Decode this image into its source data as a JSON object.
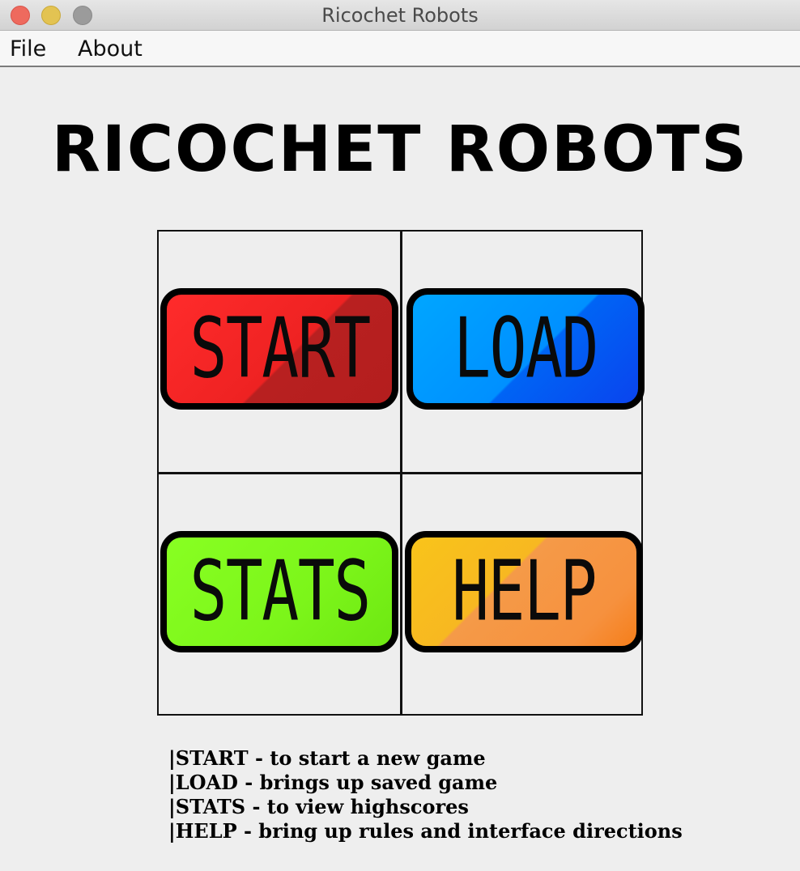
{
  "window": {
    "title": "Ricochet Robots"
  },
  "menubar": {
    "items": [
      "File",
      "About"
    ]
  },
  "heading": "RICOCHET ROBOTS",
  "buttons": [
    {
      "label": "START",
      "color": "#ee2222"
    },
    {
      "label": "LOAD",
      "color": "#0090ff"
    },
    {
      "label": "STATS",
      "color": "#7cf51a"
    },
    {
      "label": "HELP",
      "color": "#f6913e"
    }
  ],
  "instructions": [
    "|START - to start a new game",
    "|LOAD - brings up saved game",
    "|STATS - to view highscores",
    "|HELP - bring up rules and interface directions"
  ]
}
